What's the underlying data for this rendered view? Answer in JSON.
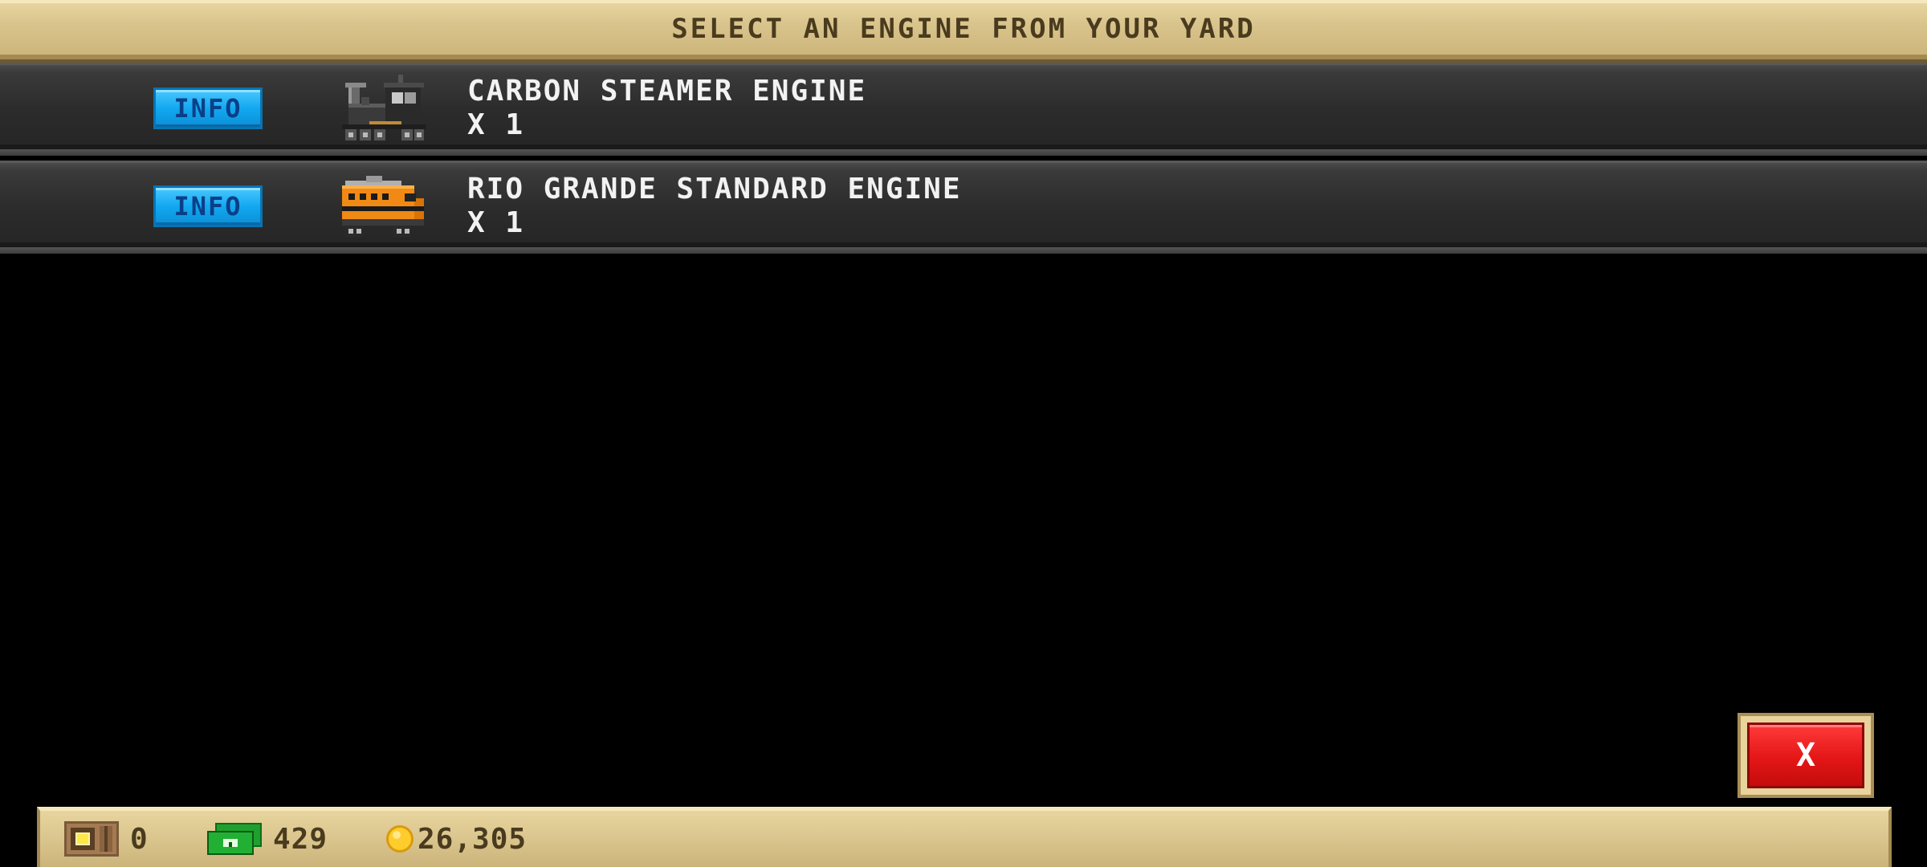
{
  "header": {
    "title": "SELECT AN ENGINE FROM YOUR YARD"
  },
  "engines": [
    {
      "info_label": "INFO",
      "name": "CARBON STEAMER ENGINE",
      "count": "X 1",
      "icon": "steam-locomotive-icon"
    },
    {
      "info_label": "INFO",
      "name": "RIO GRANDE STANDARD ENGINE",
      "count": "X 1",
      "icon": "diesel-locomotive-icon"
    }
  ],
  "close_button": {
    "label": "X"
  },
  "resources": {
    "crates": {
      "icon": "crate-icon",
      "value": "0"
    },
    "cash": {
      "icon": "cash-icon",
      "value": "429"
    },
    "coins": {
      "icon": "coin-icon",
      "value": "26,305"
    }
  },
  "colors": {
    "info_button": "#12a8f0",
    "close_button": "#e41616",
    "banner": "#d9c48d",
    "row_background": "#2c2c2c",
    "diesel_orange": "#f08a14"
  }
}
